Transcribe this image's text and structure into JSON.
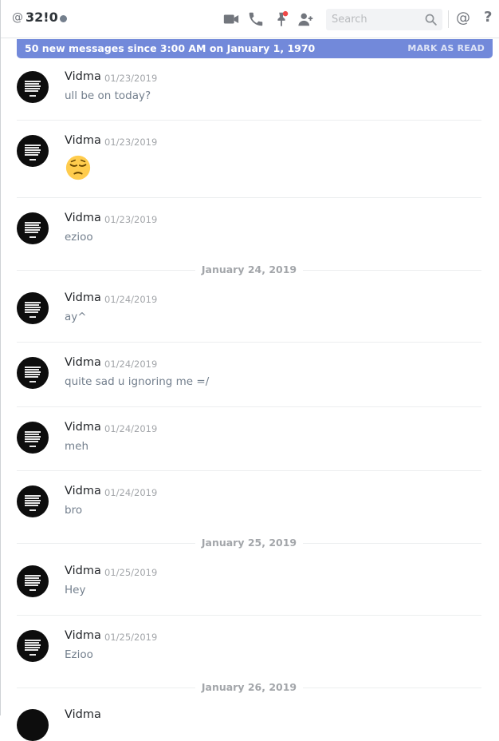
{
  "header": {
    "at_symbol": "@",
    "channel_name": "32!0",
    "search_placeholder": "Search",
    "mention_symbol": "@",
    "help_symbol": "?"
  },
  "new_messages_bar": {
    "text": "50 new messages since 3:00 AM on January 1, 1970",
    "action": "MARK AS READ"
  },
  "date_separators": [
    "January 24, 2019",
    "January 25, 2019",
    "January 26, 2019"
  ],
  "messages": [
    {
      "author": "Vidma",
      "timestamp": "01/23/2019",
      "content": "ull be on today?"
    },
    {
      "author": "Vidma",
      "timestamp": "01/23/2019",
      "content": ""
    },
    {
      "author": "Vidma",
      "timestamp": "01/23/2019",
      "content": "ezioo"
    },
    {
      "author": "Vidma",
      "timestamp": "01/24/2019",
      "content": "ay^"
    },
    {
      "author": "Vidma",
      "timestamp": "01/24/2019",
      "content": "quite sad u ignoring me =/"
    },
    {
      "author": "Vidma",
      "timestamp": "01/24/2019",
      "content": "meh"
    },
    {
      "author": "Vidma",
      "timestamp": "01/24/2019",
      "content": "bro"
    },
    {
      "author": "Vidma",
      "timestamp": "01/25/2019",
      "content": "Hey"
    },
    {
      "author": "Vidma",
      "timestamp": "01/25/2019",
      "content": "Ezioo"
    },
    {
      "author": "Vidma",
      "timestamp": "",
      "content": ""
    }
  ],
  "emoji": {
    "message_index": 1,
    "name": "pensive-face-emoji"
  },
  "colors": {
    "accent": "#7289da",
    "status_offline": "#747f8d",
    "notification": "#f04747",
    "icon": "#72767d"
  }
}
